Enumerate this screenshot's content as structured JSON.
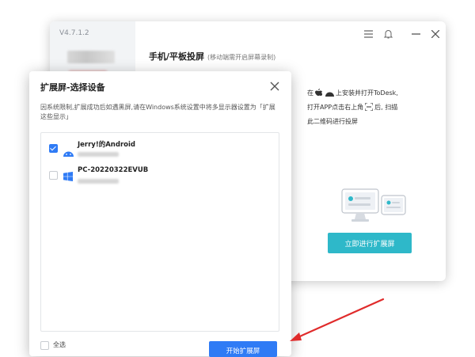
{
  "app": {
    "version": "V4.7.1.2",
    "title": "手机/平板投屏",
    "subtitle": "(移动端需开启屏幕录制)",
    "instruction_part1": "在",
    "instruction_part2": "上安装并打开ToDesk,",
    "instruction_part3": "打开APP点击右上角",
    "instruction_part4": "后, 扫描",
    "instruction_part5": "此二维码进行投屏",
    "extend_button": "立即进行扩展屏"
  },
  "dialog": {
    "title": "扩展屏-选择设备",
    "description": "因系统限制,扩展成功后如遇黑屏,请在Windows系统设置中将多显示器设置为「扩展这些显示」",
    "devices": [
      {
        "name": "Jerry!的Android",
        "checked": true,
        "icon": "android-icon"
      },
      {
        "name": "PC-20220322EVUB",
        "checked": false,
        "icon": "windows-icon"
      }
    ],
    "select_all_label": "全选",
    "start_button": "开始扩展屏"
  },
  "colors": {
    "primary": "#2f7bf5",
    "teal": "#2eb8c9",
    "annotation_red": "#e02b2b"
  }
}
